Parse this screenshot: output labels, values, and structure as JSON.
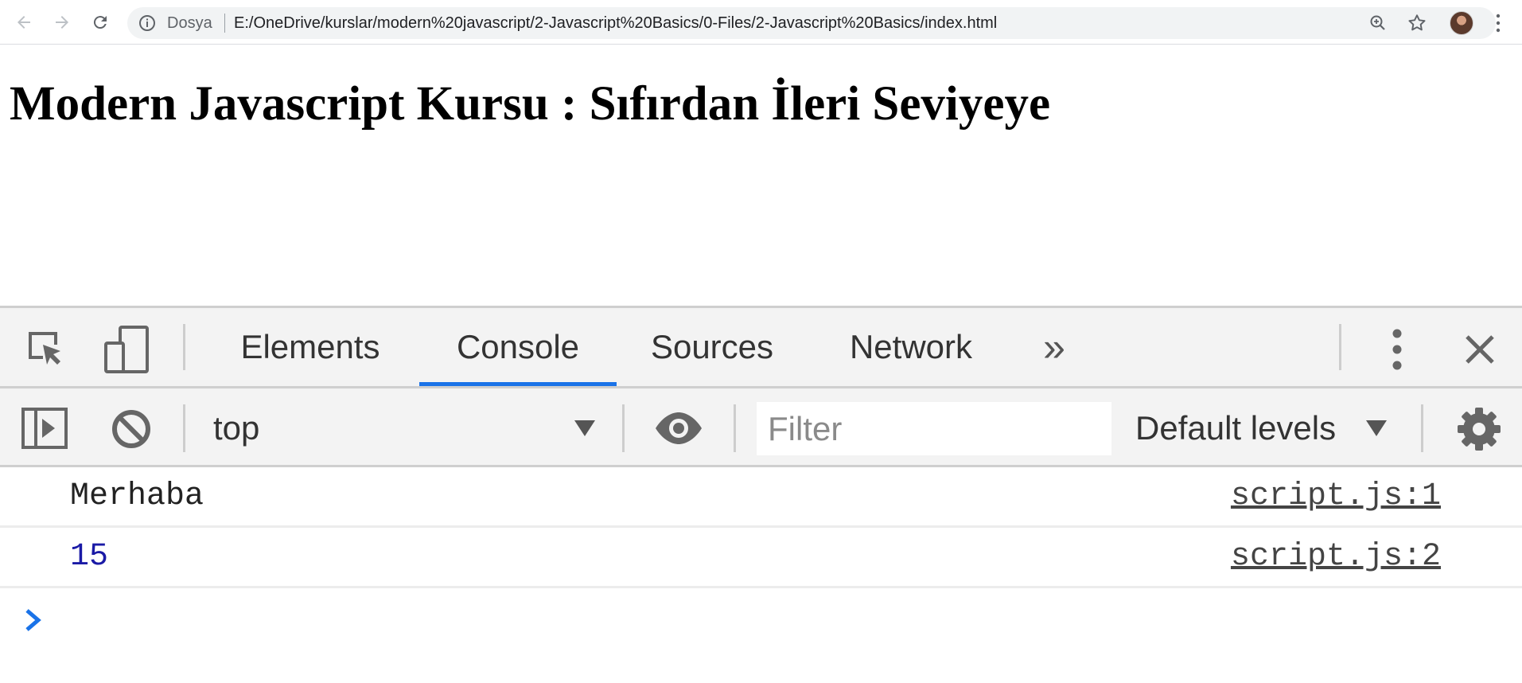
{
  "browser": {
    "omnibox_label": "Dosya",
    "url": "E:/OneDrive/kurslar/modern%20javascript/2-Javascript%20Basics/0-Files/2-Javascript%20Basics/index.html"
  },
  "page": {
    "heading": "Modern Javascript Kursu : Sıfırdan İleri Seviyeye"
  },
  "devtools": {
    "tabs": [
      {
        "label": "Elements",
        "active": false
      },
      {
        "label": "Console",
        "active": true
      },
      {
        "label": "Sources",
        "active": false
      },
      {
        "label": "Network",
        "active": false
      }
    ],
    "more_tabs_glyph": "»",
    "toolbar": {
      "context": "top",
      "filter_placeholder": "Filter",
      "levels": "Default levels"
    },
    "accent_color": "#1a73e8",
    "console_messages": [
      {
        "text": "Merhaba",
        "source": "script.js:1"
      },
      {
        "text": "15",
        "source": "script.js:2"
      }
    ],
    "prompt_glyph": "›"
  }
}
